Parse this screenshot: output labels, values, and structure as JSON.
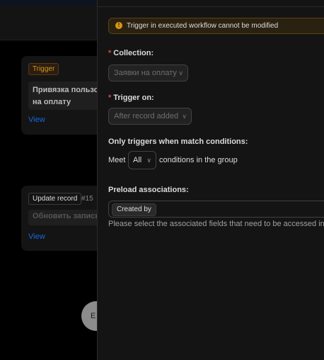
{
  "background": {
    "trigger_node": {
      "type_label": "Trigger",
      "title": "Привязка пользо на оплату",
      "view_link": "View"
    },
    "update_node": {
      "type_label": "Update record",
      "node_number": "#15",
      "title": "Обновить запись",
      "view_link": "View"
    },
    "end_node": {
      "label": "E"
    }
  },
  "drawer": {
    "alert": {
      "icon": "exclamation-icon",
      "text": "Trigger in executed workflow cannot be modified"
    },
    "collection": {
      "label": "Collection:",
      "required": "*",
      "value": "Заявки на оплату"
    },
    "trigger_on": {
      "label": "Trigger on:",
      "required": "*",
      "value": "After record added"
    },
    "conditions": {
      "label": "Only triggers when match conditions:",
      "meet_prefix": "Meet",
      "meet_value": "All",
      "meet_suffix": "conditions in the group"
    },
    "preload": {
      "label": "Preload associations:",
      "tags": [
        "Created by"
      ],
      "help": "Please select the associated fields that need to be accessed in su"
    }
  },
  "colors": {
    "warning": "#d89614",
    "required": "#dc4446",
    "link": "#1668dc",
    "drawer_bg": "#141414"
  }
}
